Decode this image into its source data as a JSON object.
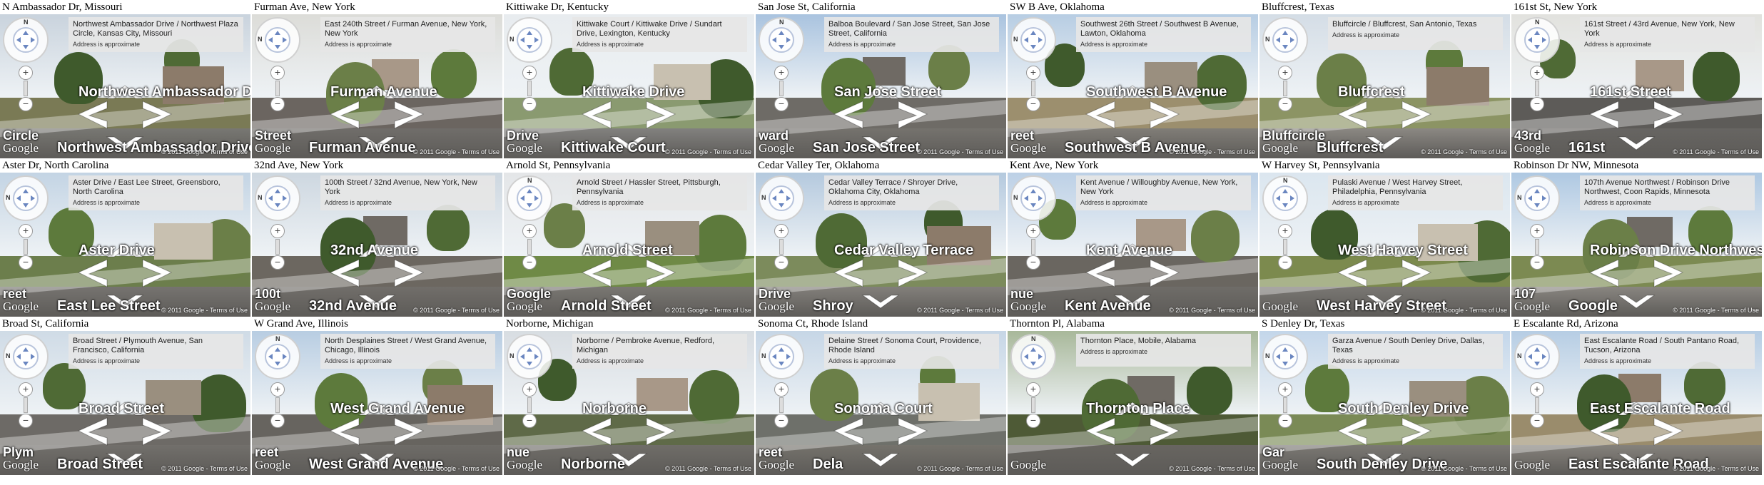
{
  "footer": {
    "copyright": "© 2011 Google - Terms of Use",
    "approx": "Address is approximate",
    "logo": "Google",
    "zoom_in": "+",
    "zoom_out": "−",
    "compass_letter": "N"
  },
  "panels": [
    {
      "caption": "N Ambassador Dr, Missouri",
      "address": "Northwest Ambassador Drive / Northwest Plaza Circle, Kansas City, Missouri",
      "streets": [
        "Northwest Ambassador Drive",
        "Circle",
        "Northwest Ambassador Drive"
      ],
      "sky": "#c9d3dd",
      "ground": "#7a7a55",
      "road": "#8a8a84"
    },
    {
      "caption": "Furman Ave, New York",
      "address": "East 240th Street / Furman Avenue, New York, New York",
      "streets": [
        "Furman Avenue",
        "Street",
        "Furman Avenue"
      ],
      "sky": "#dcdcd8",
      "ground": "#6b6560",
      "road": "#7d7a76"
    },
    {
      "caption": "Kittiwake Dr, Kentucky",
      "address": "Kittiwake Court / Kittiwake Drive / Sundart Drive, Lexington, Kentucky",
      "streets": [
        "Kittiwake Drive",
        "Drive",
        "Kittiwake Court"
      ],
      "sky": "#e8ecef",
      "ground": "#8a9a70",
      "road": "#9a9a98"
    },
    {
      "caption": "San Jose St, California",
      "address": "Balboa Boulevard / San Jose Street, San Jose Street, California",
      "streets": [
        "San Jose Street",
        "ward",
        "San Jose Street"
      ],
      "sky": "#a9c3df",
      "ground": "#6e6b66",
      "road": "#85827c"
    },
    {
      "caption": "SW B Ave, Oklahoma",
      "address": "Southwest 26th Street / Southwest B Avenue, Lawton, Oklahoma",
      "streets": [
        "Southwest B Avenue",
        "reet",
        "Southwest B Avenue"
      ],
      "sky": "#b7cde3",
      "ground": "#9c8f6e",
      "road": "#98948c"
    },
    {
      "caption": "Bluffcrest, Texas",
      "address": "Bluffcircle / Bluffcrest, San Antonio, Texas",
      "streets": [
        "Bluffcrest",
        "Bluffcircle",
        "Bluffcrest"
      ],
      "sky": "#d4dde6",
      "ground": "#8c9464",
      "road": "#aaa6a0"
    },
    {
      "caption": "161st St, New York",
      "address": "161st Street / 43rd Avenue, New York, New York",
      "streets": [
        "161st Street",
        "43rd",
        "161st"
      ],
      "sky": "#e2e2de",
      "ground": "#5d5b58",
      "road": "#6e6c69"
    },
    {
      "caption": "Aster Dr, North Carolina",
      "address": "Aster Drive / East Lee Street, Greensboro, North Carolina",
      "streets": [
        "Aster Drive",
        "reet",
        "East Lee Street"
      ],
      "sky": "#c3d4e4",
      "ground": "#6c7e4c",
      "road": "#878480"
    },
    {
      "caption": "32nd Ave, New York",
      "address": "100th Street / 32nd Avenue, New York, New York",
      "streets": [
        "32nd Avenue",
        "100t",
        "32nd Avenue"
      ],
      "sky": "#cdd7e0",
      "ground": "#6c6760",
      "road": "#7f7b76"
    },
    {
      "caption": "Arnold St, Pennsylvania",
      "address": "Arnold Street / Hassler Street, Pittsburgh, Pennsylvania",
      "streets": [
        "Arnold Street",
        "Google",
        "Arnold Street"
      ],
      "sky": "#e4e6e8",
      "ground": "#6f8a46",
      "road": "#8d8a84"
    },
    {
      "caption": "Cedar Valley Ter, Oklahoma",
      "address": "Cedar Valley Terrace / Shroyer Drive, Oklahoma City, Oklahoma",
      "streets": [
        "Cedar Valley Terrace",
        "Drive",
        "Shroy"
      ],
      "sky": "#b4c9de",
      "ground": "#7c8b5c",
      "road": "#9c9892"
    },
    {
      "caption": "Kent Ave, New York",
      "address": "Kent Avenue / Willoughby Avenue, New York, New York",
      "streets": [
        "Kent Avenue",
        "nue",
        "Kent Avenue"
      ],
      "sky": "#bcd0e6",
      "ground": "#6a6660",
      "road": "#7b7873"
    },
    {
      "caption": "W Harvey St, Pennsylvania",
      "address": "Pulaski Avenue / West Harvey Street, Philadelphia, Pennsylvania",
      "streets": [
        "West Harvey Street",
        "",
        "West Harvey Street"
      ],
      "sky": "#dbe6ef",
      "ground": "#7c8a4e",
      "road": "#8d8a85"
    },
    {
      "caption": "Robinson Dr NW, Minnesota",
      "address": "107th Avenue Northwest / Robinson Drive Northwest, Coon Rapids, Minnesota",
      "streets": [
        "Robinson Drive Northwest",
        "107",
        "Google"
      ],
      "sky": "#aec8e2",
      "ground": "#7c8a52",
      "road": "#a7a39c"
    },
    {
      "caption": "Broad St, California",
      "address": "Broad Street / Plymouth Avenue, San Francisco, California",
      "streets": [
        "Broad Street",
        "Plym",
        "Broad Street"
      ],
      "sky": "#cfdbe6",
      "ground": "#6d6a66",
      "road": "#807d78"
    },
    {
      "caption": "W Grand Ave, Illinois",
      "address": "North Desplaines Street / West Grand Avenue, Chicago, Illinois",
      "streets": [
        "West Grand Avenue",
        "reet",
        "West Grand Avenue"
      ],
      "sky": "#b8cde2",
      "ground": "#67645f",
      "road": "#7a7772"
    },
    {
      "caption": "Norborne, Michigan",
      "address": "Norborne / Pembroke Avenue, Redford, Michigan",
      "streets": [
        "Norborne",
        "nue",
        "Norborne"
      ],
      "sky": "#d8dde2",
      "ground": "#5f6a48",
      "road": "#7c7973"
    },
    {
      "caption": "Sonoma Ct, Rhode Island",
      "address": "Delaine Street / Sonoma Court, Providence, Rhode Island",
      "streets": [
        "Sonoma Court",
        "reet",
        "Dela"
      ],
      "sky": "#c6d6e6",
      "ground": "#6e706a",
      "road": "#858279"
    },
    {
      "caption": "Thornton Pl, Alabama",
      "address": "Thornton Place, Mobile, Alabama",
      "streets": [
        "Thornton Place",
        "",
        ""
      ],
      "sky": "#a8b89a",
      "ground": "#4e5a36",
      "road": "#6f6c66"
    },
    {
      "caption": "S Denley Dr, Texas",
      "address": "Garza Avenue / South Denley Drive, Dallas, Texas",
      "streets": [
        "South Denley Drive",
        "Gar",
        "South Denley Drive"
      ],
      "sky": "#c3d6ea",
      "ground": "#7a8a56",
      "road": "#8f8c86"
    },
    {
      "caption": "E Escalante Rd, Arizona",
      "address": "East Escalante Road / South Pantano Road, Tucson, Arizona",
      "streets": [
        "East Escalante Road",
        "",
        "East Escalante Road"
      ],
      "sky": "#b6cde4",
      "ground": "#9a8c6c",
      "road": "#a19c94"
    }
  ],
  "row4_captions": [
    "",
    "",
    "",
    "",
    "",
    "",
    ""
  ]
}
